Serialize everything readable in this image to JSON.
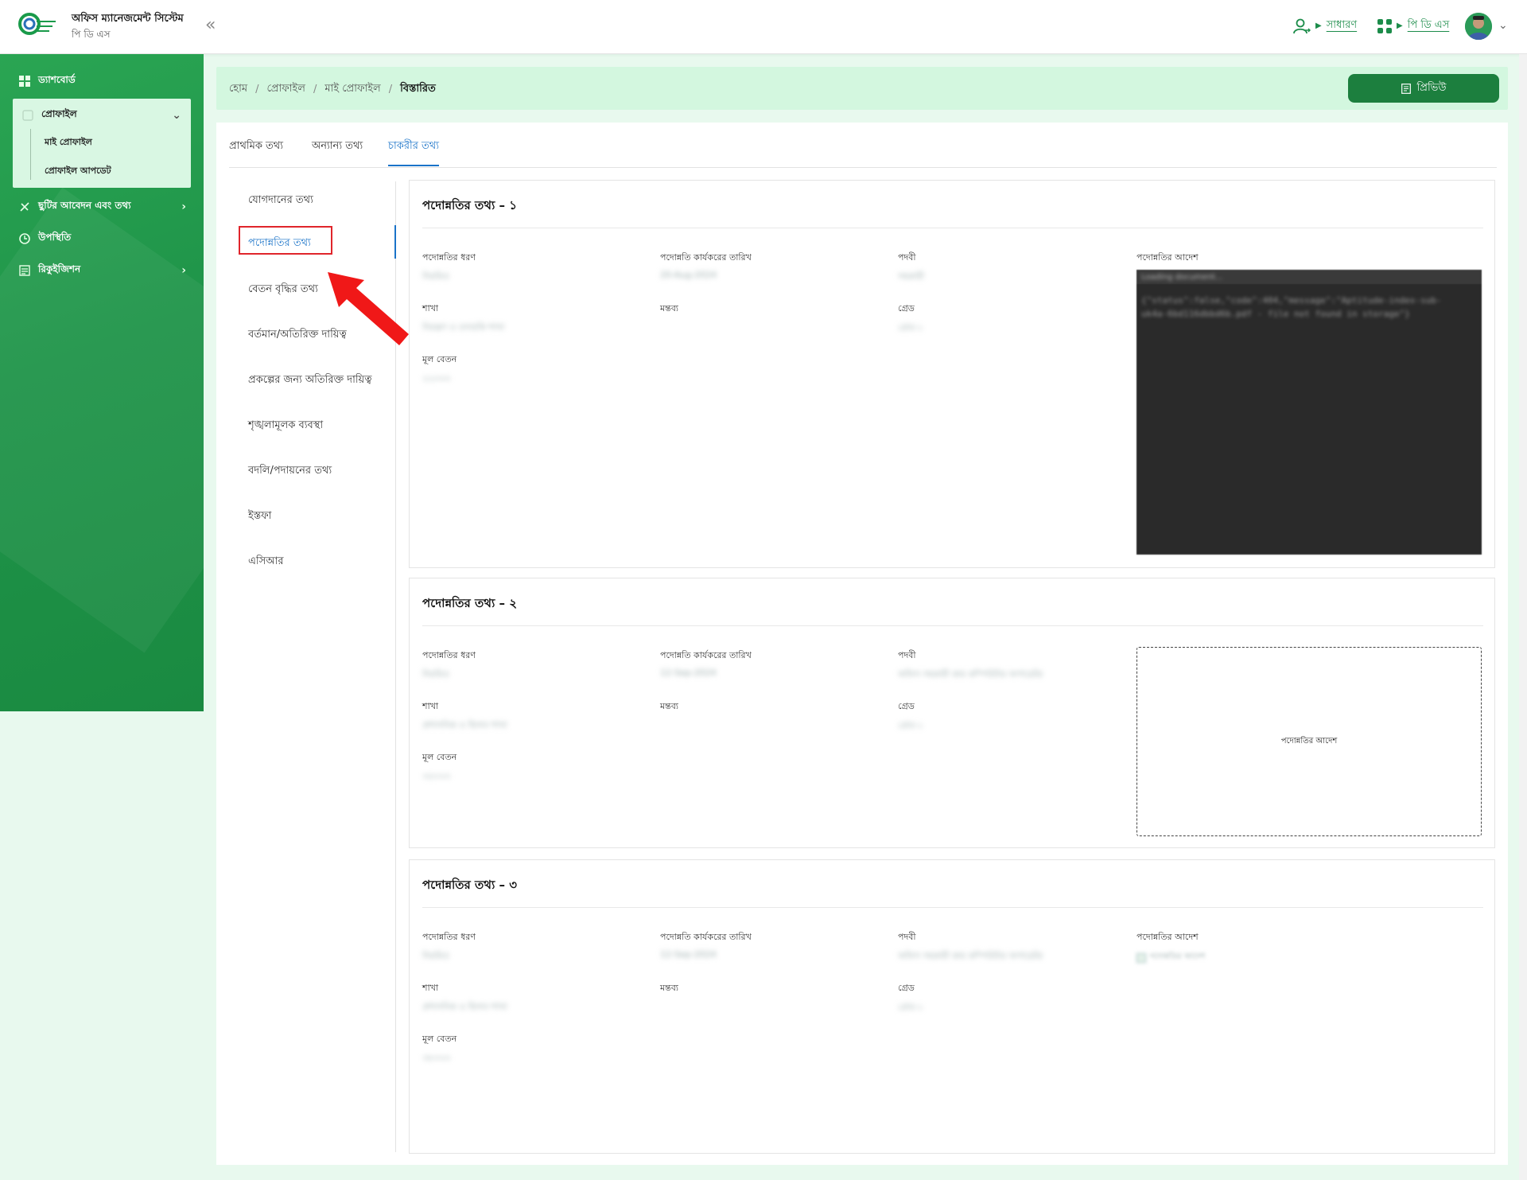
{
  "header": {
    "app_title": "অফিস ম্যানেজমেন্ট সিস্টেম",
    "app_subtitle": "পি ডি এস",
    "role_label": "সাধারণ",
    "module_label": "পি ডি এস",
    "collapse_icon": "double-chevron-left-icon"
  },
  "sidebar": {
    "items": [
      {
        "label": "ড্যাশবোর্ড",
        "icon": "grid-icon"
      },
      {
        "label": "প্রোফাইল",
        "icon": "profile-icon",
        "expanded": true,
        "children": [
          {
            "label": "মাই প্রোফাইল"
          },
          {
            "label": "প্রোফাইল আপডেট"
          }
        ]
      },
      {
        "label": "ছুটির আবেদন এবং তথ্য",
        "icon": "leave-icon"
      },
      {
        "label": "উপস্থিতি",
        "icon": "clock-icon"
      },
      {
        "label": "রিকুইজিশন",
        "icon": "requisition-icon"
      }
    ]
  },
  "breadcrumb": {
    "items": [
      "হোম",
      "প্রোফাইল",
      "মাই প্রোফাইল",
      "বিস্তারিত"
    ],
    "separator": "/"
  },
  "preview_button": {
    "label": "প্রিভিউ",
    "icon": "document-icon"
  },
  "tabs": [
    {
      "label": "প্রাথমিক তথ্য",
      "active": false
    },
    {
      "label": "অন্যান্য তথ্য",
      "active": false
    },
    {
      "label": "চাকরীর তথ্য",
      "active": true
    }
  ],
  "subnav": [
    {
      "label": "যোগদানের তথ্য",
      "active": false
    },
    {
      "label": "পদোন্নতির তথ্য",
      "active": true
    },
    {
      "label": "বেতন বৃদ্ধির তথ্য",
      "active": false
    },
    {
      "label": "বর্তমান/অতিরিক্ত দায়িত্ব",
      "active": false
    },
    {
      "label": "প্রকল্পের জন্য অতিরিক্ত দায়িত্ব",
      "active": false
    },
    {
      "label": "শৃঙ্খলামূলক ব্যবস্থা",
      "active": false
    },
    {
      "label": "বদলি/পদায়নের তথ্য",
      "active": false
    },
    {
      "label": "ইস্তফা",
      "active": false
    },
    {
      "label": "এসিআর",
      "active": false
    }
  ],
  "labels": {
    "type": "পদোন্নতির ধরণ",
    "effective_date": "পদোন্নতি কার্যকরের তারিখ",
    "designation": "পদবী",
    "order": "পদোন্নতির আদেশ",
    "branch": "শাখা",
    "remarks": "মন্তব্য",
    "grade": "গ্রেড",
    "basic_salary": "মূল বেতন"
  },
  "cards": [
    {
      "title": "পদোন্নতির তথ্য – ১",
      "type_value": "নিয়মিত",
      "date_value": "20-Aug-2024",
      "designation_value": "সহকারী",
      "branch_value": "নিয়ন্ত্রণ ও তদারকি শাখা",
      "grade_value": "গ্রেড-১",
      "salary_value": "২২০০০",
      "doc": {
        "title": "Loading document...",
        "text": "{\"status\":false,\"code\":404,\"message\":\"Aptitude-index-sub-uk4a-6bd116dbbd6b.pdf - file not found in storage\"}"
      }
    },
    {
      "title": "পদোন্নতির তথ্য – ২",
      "type_value": "নিয়মিত",
      "date_value": "12-Sep-2024",
      "designation_value": "অফিস সহকারী কাম কম্পিউটার অপারেটর",
      "branch_value": "প্রশাসনিক ও হিসাব শাখা",
      "grade_value": "গ্রেড-১",
      "salary_value": "৩৫০০০",
      "order_placeholder": "পদোন্নতির আদেশ"
    },
    {
      "title": "পদোন্নতির তথ্য – ৩",
      "type_value": "নিয়মিত",
      "date_value": "12-Sep-2024",
      "designation_value": "অফিস সহকারী কাম কম্পিউটার অপারেটর",
      "branch_value": "প্রশাসনিক ও হিসাব শাখা",
      "grade_value": "গ্রেড-১",
      "salary_value": "৩৮০০০",
      "order_image_alt": "পদোন্নতির আদেশ"
    }
  ],
  "colors": {
    "brand_green": "#1c7f3e",
    "sidebar_green": "#1f9449",
    "active_blue": "#1a73c8",
    "highlight_red": "#e0252b",
    "page_bg": "#e8f9ee"
  }
}
